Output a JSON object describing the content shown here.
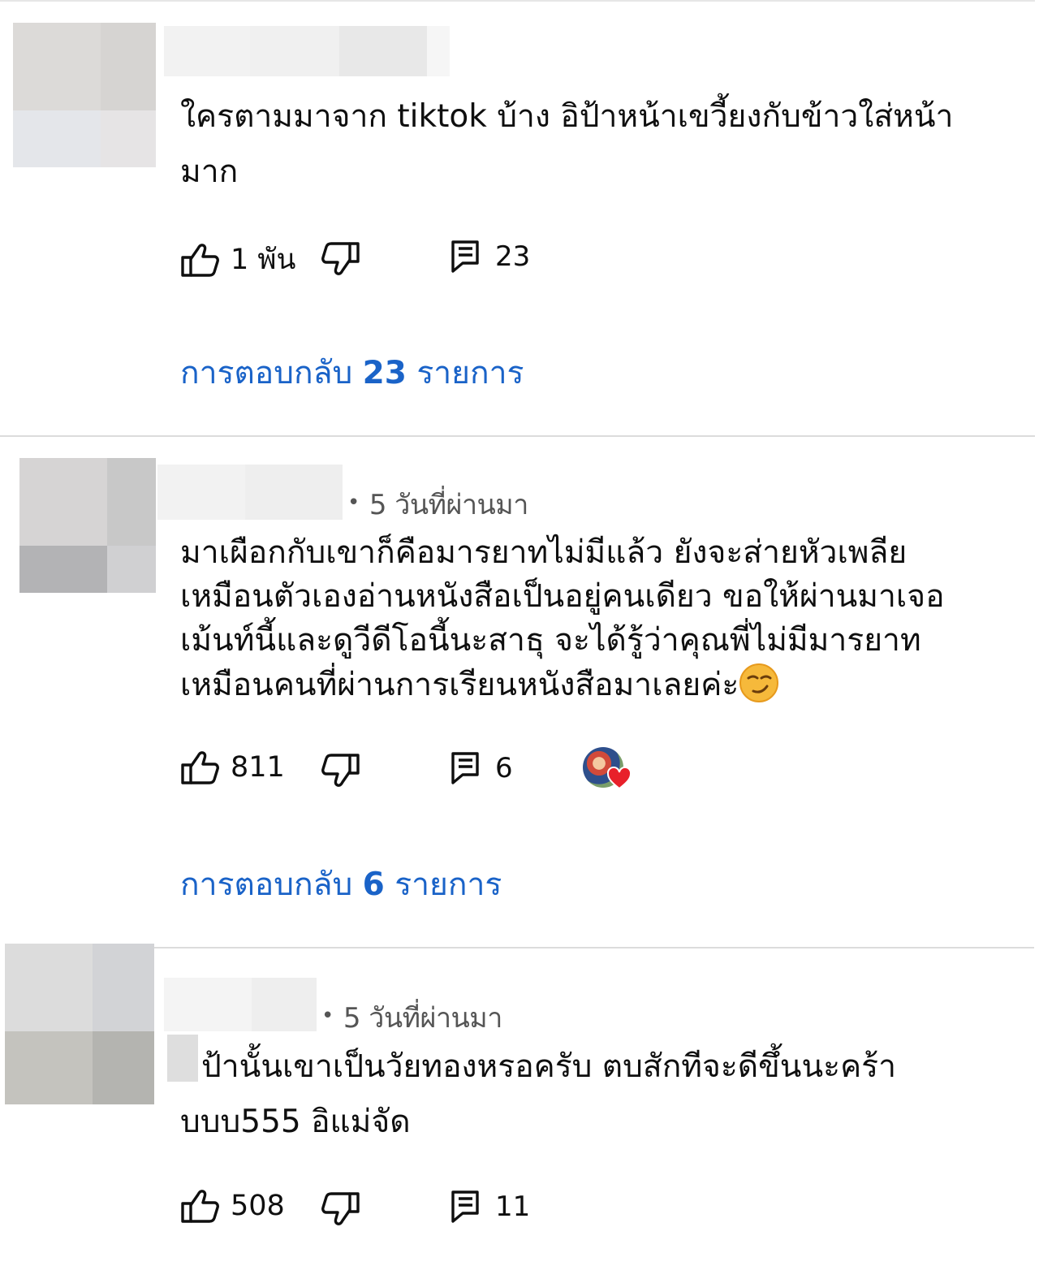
{
  "comments": [
    {
      "time": "",
      "text": "ใครตามมาจาก tiktok บ้าง อิป้าหน้าเขวี้ยงกับข้าวใส่หน้ามาก",
      "likes": "1 พัน",
      "reply_count": "23",
      "replies_link": {
        "prefix": "การตอบกลับ",
        "count": "23",
        "suffix": "รายการ"
      }
    },
    {
      "time": "5 วันที่ผ่านมา",
      "text": "มาเผือกกับเขาก็คือมารยาทไม่มีแล้ว ยังจะส่ายหัวเพลียเหมือนตัวเองอ่านหนังสือเป็นอยู่คนเดียว ขอให้ผ่านมาเจอเม้นท์นี้และดูวีดีโอนี้นะสาธุ จะได้รู้ว่าคุณพี่ไม่มีมารยาทเหมือนคนที่ผ่านการเรียนหนังสือมาเลยค่ะ",
      "likes": "811",
      "reply_count": "6",
      "replies_link": {
        "prefix": "การตอบกลับ",
        "count": "6",
        "suffix": "รายการ"
      }
    },
    {
      "time": "5 วันที่ผ่านมา",
      "text": "ป้านั้นเขาเป็นวัยทองหรอครับ ตบสักทีจะดีขึ้นนะคร้าบบบ555 อิแม่จัด",
      "likes": "508",
      "reply_count": "11"
    }
  ],
  "icons": {
    "like": "thumbs-up-icon",
    "dislike": "thumbs-down-icon",
    "reply": "comment-icon",
    "hearted": "creator-heart-icon",
    "emoji": "smirking-face-emoji"
  },
  "colors": {
    "link": "#1a63c8",
    "heart": "#e8202a",
    "divider": "#dcdcdc",
    "meta": "#555555"
  }
}
